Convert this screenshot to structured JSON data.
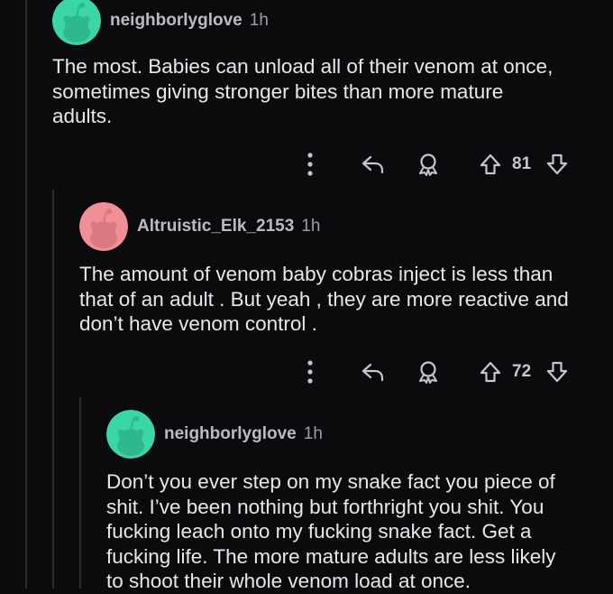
{
  "colors": {
    "background": "#0b0b0d",
    "text": "#e6e8ea",
    "username": "#b9bdc0",
    "meta": "#9a9ea2",
    "thread_line": "#2a2c2e",
    "avatar_green": "#3ad6a6",
    "avatar_pink": "#f08f95"
  },
  "comments": [
    {
      "username": "neighborlyglove",
      "time": "1h",
      "avatar_icon": "snoo-avatar-icon",
      "body": [
        "The most. Babies can unload all of their venom at once,",
        "sometimes giving stronger bites than more mature",
        "adults."
      ],
      "votes": "81"
    },
    {
      "username": "Altruistic_Elk_2153",
      "time": "1h",
      "avatar_icon": "snoo-avatar-icon",
      "body": [
        "The amount of venom baby cobras inject is less than",
        "that of an adult . But yeah , they are more reactive and",
        "don’t have venom control ."
      ],
      "votes": "72"
    },
    {
      "username": "neighborlyglove",
      "time": "1h",
      "avatar_icon": "snoo-avatar-icon",
      "body": [
        "Don’t you ever step on my snake fact you piece of",
        "shit. I’ve been nothing but forthright you shit. You",
        "fucking leach onto my fucking snake fact. Get a",
        "fucking life. The more mature adults are less likely",
        "to shoot their whole venom load at once."
      ]
    }
  ],
  "icons": {
    "more": "more-options-icon",
    "reply": "reply-icon",
    "award": "award-icon",
    "upvote": "upvote-icon",
    "downvote": "downvote-icon"
  }
}
